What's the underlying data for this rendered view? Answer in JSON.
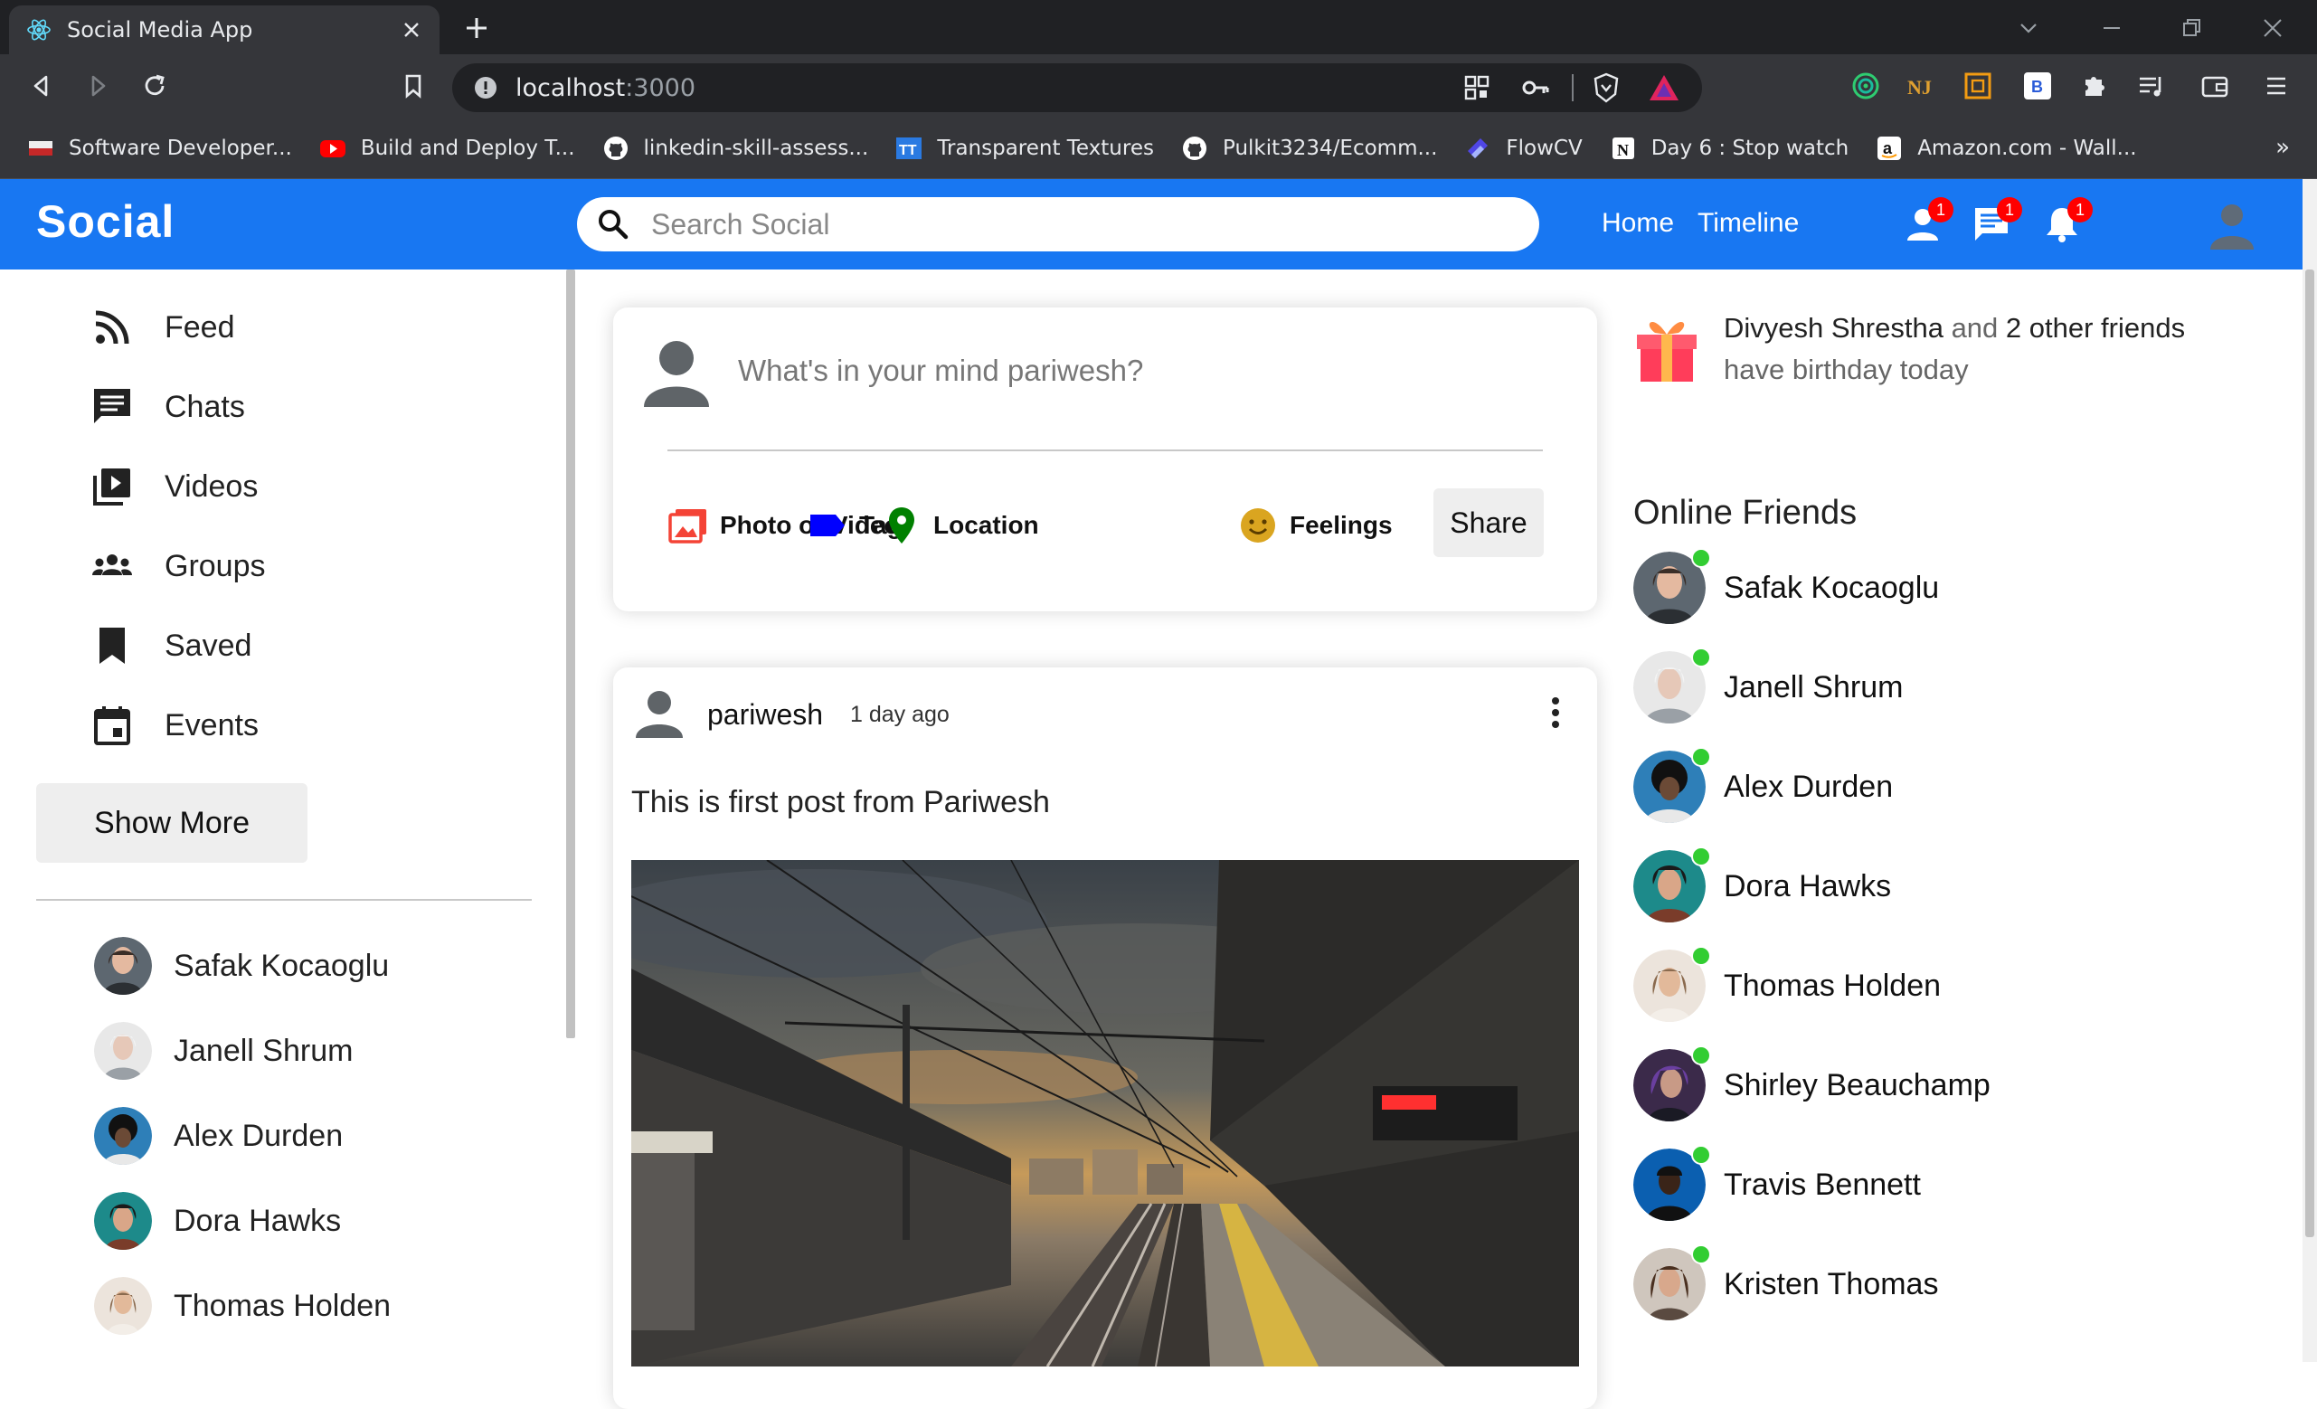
{
  "browser": {
    "tab_title": "Social Media App",
    "url_host": "localhost",
    "url_port": ":3000",
    "bookmarks": [
      {
        "label": "Software Developer...",
        "icon": "flag-icon",
        "color": "#c62828"
      },
      {
        "label": "Build and Deploy T...",
        "icon": "youtube-icon",
        "color": "#ff0000"
      },
      {
        "label": "linkedin-skill-assess...",
        "icon": "github-icon",
        "color": "#ffffff"
      },
      {
        "label": "Transparent Textures",
        "icon": "tt-icon",
        "color": "#2a7ae2"
      },
      {
        "label": "Pulkit3234/Ecomm...",
        "icon": "github-icon",
        "color": "#ffffff"
      },
      {
        "label": "FlowCV",
        "icon": "flowcv-icon",
        "color": "#4f46e5"
      },
      {
        "label": "Day 6 : Stop watch",
        "icon": "notion-icon",
        "color": "#ffffff"
      },
      {
        "label": "Amazon.com - Wall...",
        "icon": "amazon-icon",
        "color": "#ffffff"
      }
    ],
    "bookmarks_more": "»"
  },
  "topbar": {
    "logo": "Social",
    "search_placeholder": "Search Social",
    "links": [
      "Home",
      "Timeline"
    ],
    "badges": {
      "friends": "1",
      "chat": "1",
      "notifications": "1"
    },
    "accent": "#1877f2"
  },
  "sidebar": {
    "items": [
      {
        "label": "Feed",
        "icon": "rss-feed-icon"
      },
      {
        "label": "Chats",
        "icon": "chat-icon"
      },
      {
        "label": "Videos",
        "icon": "video-library-icon"
      },
      {
        "label": "Groups",
        "icon": "groups-icon"
      },
      {
        "label": "Saved",
        "icon": "bookmark-icon"
      },
      {
        "label": "Events",
        "icon": "event-icon"
      }
    ],
    "show_more": "Show More",
    "friends": [
      "Safak Kocaoglu",
      "Janell Shrum",
      "Alex Durden",
      "Dora Hawks",
      "Thomas Holden"
    ]
  },
  "share": {
    "placeholder": "What's in your mind pariwesh?",
    "options": [
      {
        "label": "Photo or Video",
        "icon": "photo-icon",
        "color": "#f44336"
      },
      {
        "label": "Tag",
        "icon": "label-icon",
        "color": "#0000ff"
      },
      {
        "label": "Location",
        "icon": "location-icon",
        "color": "#008000"
      },
      {
        "label": "Feelings",
        "icon": "emoji-icon",
        "color": "#daa520"
      }
    ],
    "button": "Share"
  },
  "post": {
    "username": "pariwesh",
    "time": "1 day ago",
    "text": "This is first post from Pariwesh"
  },
  "rightbar": {
    "birthday_name": "Divyesh Shrestha",
    "birthday_mid": " and ",
    "birthday_count": "2 other friends",
    "birthday_tail": "have birthday today",
    "online_title": "Online Friends",
    "online_friends": [
      "Safak Kocaoglu",
      "Janell Shrum",
      "Alex Durden",
      "Dora Hawks",
      "Thomas Holden",
      "Shirley Beauchamp",
      "Travis Bennett",
      "Kristen Thomas"
    ],
    "online_color": "#32cd32"
  }
}
